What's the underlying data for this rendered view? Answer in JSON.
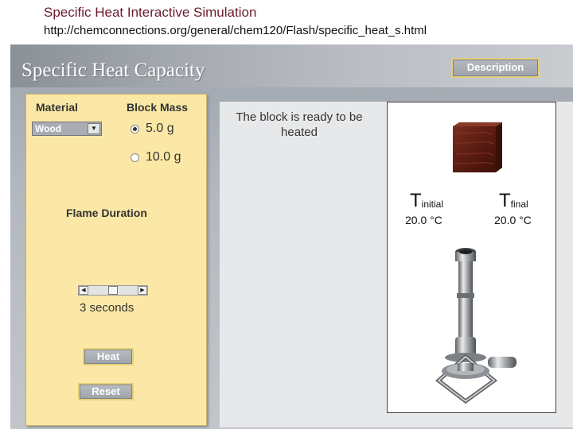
{
  "slide": {
    "title": "Specific Heat Interactive Simulation",
    "url": "http://chemconnections.org/general/chem120/Flash/specific_heat_s.html"
  },
  "app": {
    "title": "Specific Heat Capacity",
    "description_label": "Description"
  },
  "controls": {
    "material_label": "Material",
    "material_value": "Wood",
    "mass_label": "Block Mass",
    "mass_options": [
      "5.0 g",
      "10.0 g"
    ],
    "mass_selected": "5.0 g",
    "duration_label": "Flame Duration",
    "duration_value": "3 seconds",
    "heat_label": "Heat",
    "reset_label": "Reset"
  },
  "status": {
    "message": "The block is ready to be heated"
  },
  "temperatures": {
    "initial_symbol": "T",
    "initial_sub": "initial",
    "initial_value": "20.0 °C",
    "final_symbol": "T",
    "final_sub": "final",
    "final_value": "20.0 °C"
  },
  "icons": {
    "block": "wood-block-icon",
    "burner": "bunsen-burner-icon"
  },
  "colors": {
    "slide_title": "#6b1a2e",
    "panel_bg": "#fbe8a6",
    "button_border": "#e4d07a"
  }
}
